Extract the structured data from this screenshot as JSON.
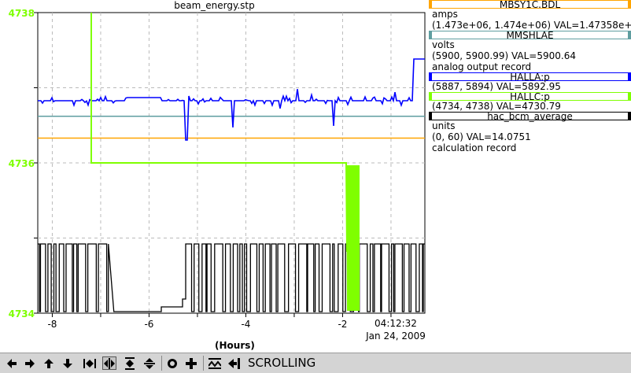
{
  "window": {
    "title": "beam_energy.stp"
  },
  "chart_data": {
    "type": "line",
    "title": "beam_energy.stp",
    "xlabel": "(Hours)",
    "ylabel": "",
    "xlim": [
      -8.3,
      -0.3
    ],
    "ylim": [
      4734,
      4738
    ],
    "x_ticks": [
      "-8",
      "-6",
      "-4",
      "-2"
    ],
    "y_ticks": [
      "4738",
      "4736",
      "4734"
    ],
    "time_stamp": "04:12:32",
    "date_stamp": "Jan 24, 2009",
    "grid": true,
    "series": [
      {
        "name": "MBSY1C.BDL",
        "color": "#ffa500",
        "level": 4736.33
      },
      {
        "name": "MMSHLAE",
        "color": "#5f9ea0",
        "level": 4736.62
      },
      {
        "name": "HALLA:p",
        "color": "#0000ff"
      },
      {
        "name": "HALLC:p",
        "color": "#7fff00"
      },
      {
        "name": "hac_bcm_average",
        "color": "#000000"
      }
    ]
  },
  "legend": {
    "items": [
      {
        "name": "MBSY1C.BDL",
        "color": "#ffa500",
        "lines": [
          "amps",
          "(1.473e+06, 1.474e+06)  VAL=1.47358e+06"
        ]
      },
      {
        "name": "MMSHLAE",
        "color": "#5f9ea0",
        "lines": [
          "volts",
          "(5900, 5900.99) VAL=5900.64",
          "analog output record"
        ]
      },
      {
        "name": "HALLA:p",
        "color": "#0000ff",
        "lines": [
          "(5887, 5894) VAL=5892.95"
        ]
      },
      {
        "name": "HALLC:p",
        "color": "#7fff00",
        "lines": [
          "(4734, 4738) VAL=4730.79"
        ]
      },
      {
        "name": "hac_bcm_average",
        "color": "#000000",
        "lines": [
          "units",
          "(0, 60) VAL=14.0751",
          "calculation record"
        ]
      }
    ]
  },
  "toolbar": {
    "status": "SCROLLING",
    "buttons": [
      "arrow-left-icon",
      "arrow-right-icon",
      "arrow-up-icon",
      "arrow-down-icon",
      "zoom-in-horizontal-icon",
      "zoom-out-horizontal-icon",
      "zoom-in-vertical-icon",
      "zoom-out-vertical-icon",
      "config-icon",
      "add-icon",
      "scroll-icon",
      "cursor-icon"
    ]
  }
}
